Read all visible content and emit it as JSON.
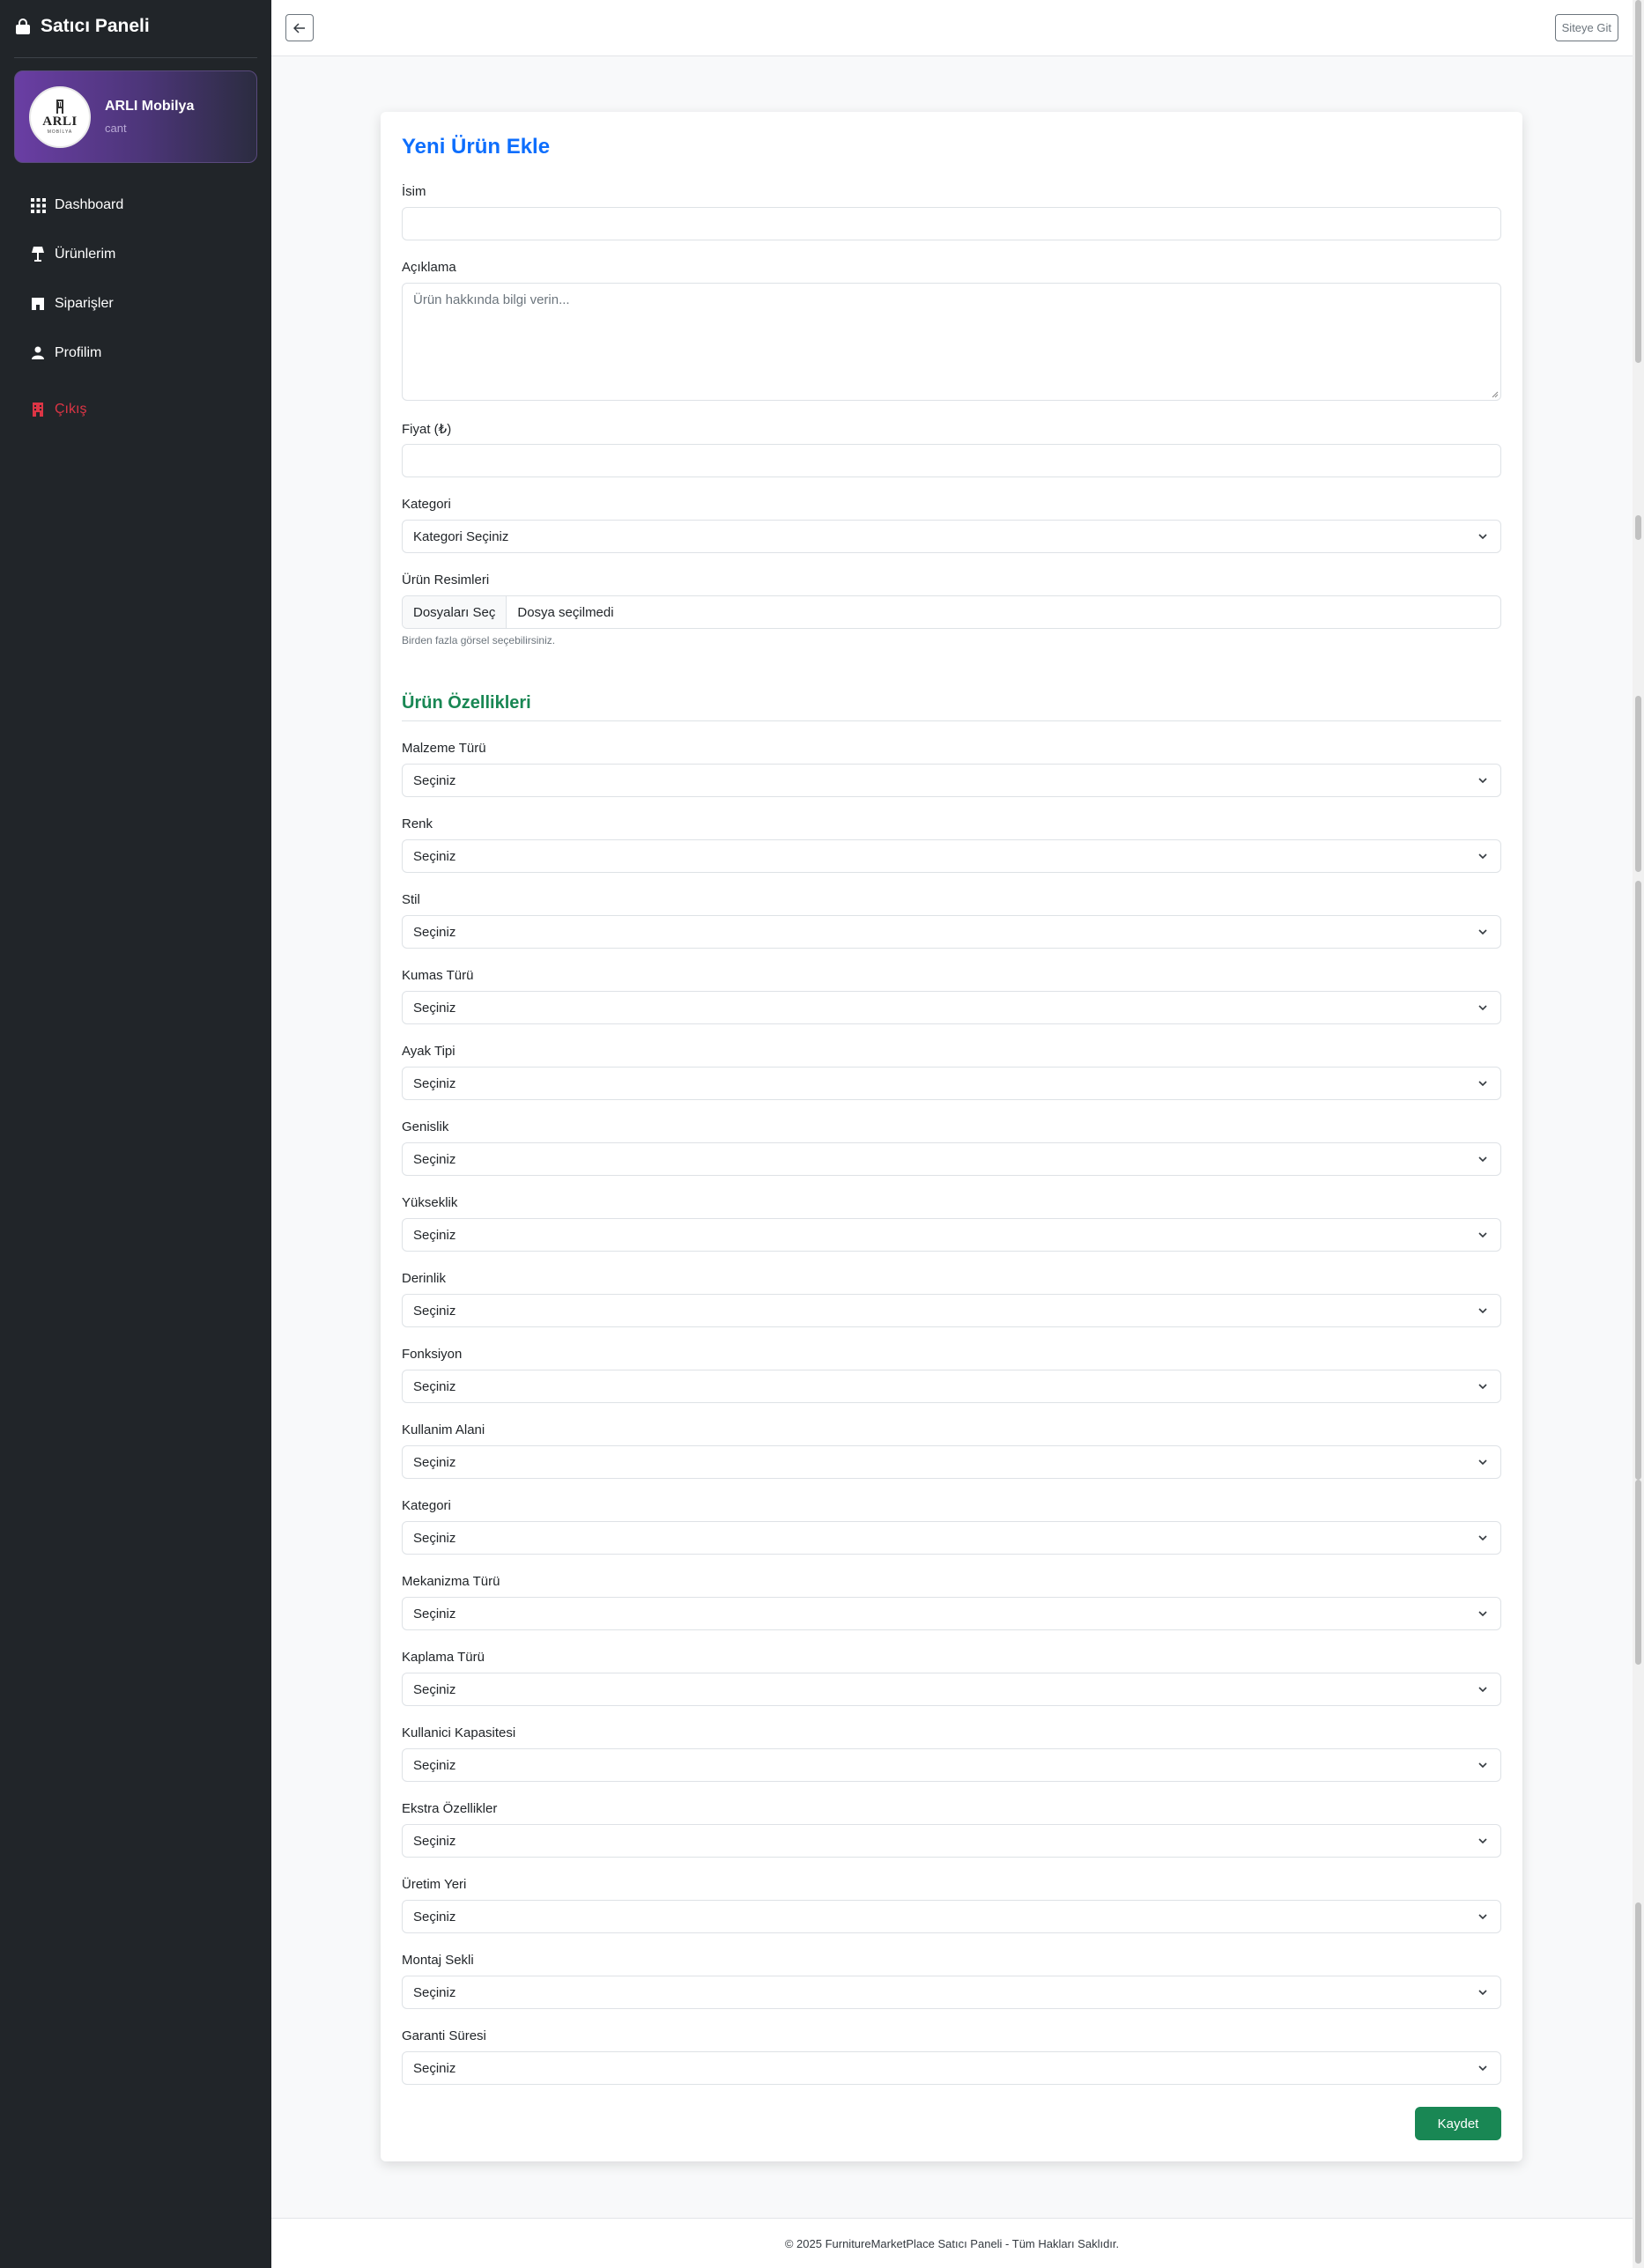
{
  "sidebar": {
    "brand_title": "Satıcı Paneli",
    "profile": {
      "name": "ARLI Mobilya",
      "username": "cant",
      "logo_text": "ARLI",
      "logo_sub": "MOBİLYA"
    },
    "items": [
      {
        "label": "Dashboard",
        "icon": "grid-icon"
      },
      {
        "label": "Ürünlerim",
        "icon": "lamp-icon"
      },
      {
        "label": "Siparişler",
        "icon": "shop-icon"
      },
      {
        "label": "Profilim",
        "icon": "person-icon"
      }
    ],
    "logout_label": "Çıkış"
  },
  "topbar": {
    "site_button": "Siteye Git"
  },
  "form": {
    "title": "Yeni Ürün Ekle",
    "name_label": "İsim",
    "name_value": "",
    "description_label": "Açıklama",
    "description_placeholder": "Ürün hakkında bilgi verin...",
    "price_label": "Fiyat (₺)",
    "price_value": "",
    "category_label": "Kategori",
    "category_value": "Kategori Seçiniz",
    "images_label": "Ürün Resimleri",
    "file_button": "Dosyaları Seç",
    "file_status": "Dosya seçilmedi",
    "images_help": "Birden fazla görsel seçebilirsiniz.",
    "features_title": "Ürün Özellikleri",
    "features": [
      {
        "label": "Malzeme Türü",
        "value": "Seçiniz"
      },
      {
        "label": "Renk",
        "value": "Seçiniz"
      },
      {
        "label": "Stil",
        "value": "Seçiniz"
      },
      {
        "label": "Kumas Türü",
        "value": "Seçiniz"
      },
      {
        "label": "Ayak Tipi",
        "value": "Seçiniz"
      },
      {
        "label": "Genislik",
        "value": "Seçiniz"
      },
      {
        "label": "Yükseklik",
        "value": "Seçiniz"
      },
      {
        "label": "Derinlik",
        "value": "Seçiniz"
      },
      {
        "label": "Fonksiyon",
        "value": "Seçiniz"
      },
      {
        "label": "Kullanim Alani",
        "value": "Seçiniz"
      },
      {
        "label": "Kategori",
        "value": "Seçiniz"
      },
      {
        "label": "Mekanizma Türü",
        "value": "Seçiniz"
      },
      {
        "label": "Kaplama Türü",
        "value": "Seçiniz"
      },
      {
        "label": "Kullanici Kapasitesi",
        "value": "Seçiniz"
      },
      {
        "label": "Ekstra Özellikler",
        "value": "Seçiniz"
      },
      {
        "label": "Üretim Yeri",
        "value": "Seçiniz"
      },
      {
        "label": "Montaj Sekli",
        "value": "Seçiniz"
      },
      {
        "label": "Garanti Süresi",
        "value": "Seçiniz"
      }
    ],
    "save_button": "Kaydet"
  },
  "footer": {
    "text": "© 2025 FurnitureMarketPlace Satıcı Paneli - Tüm Hakları Saklıdır."
  },
  "colors": {
    "sidebar_bg": "#212529",
    "primary": "#0d6efd",
    "success": "#198754",
    "danger": "#dc3545"
  }
}
